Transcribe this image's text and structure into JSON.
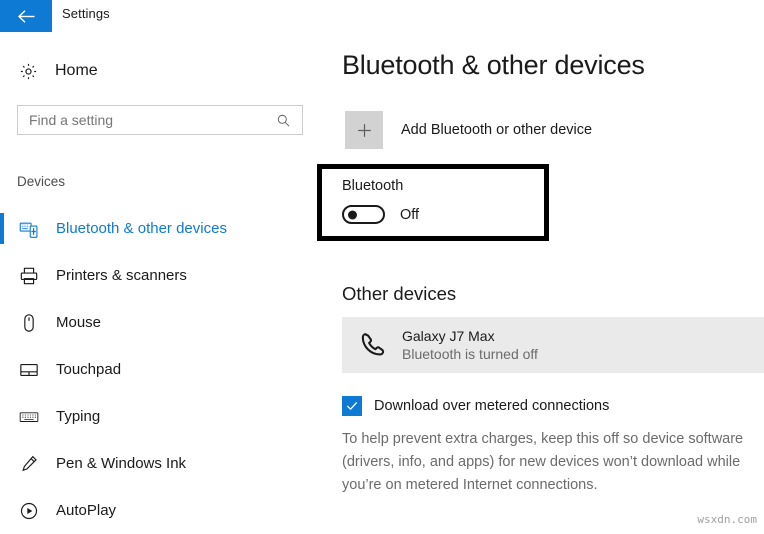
{
  "window": {
    "title": "Settings",
    "back_icon": "back-arrow-icon",
    "accent_color": "#0f7ad4"
  },
  "sidebar": {
    "home_label": "Home",
    "home_icon": "gear-icon",
    "search": {
      "placeholder": "Find a setting",
      "value": "",
      "icon": "search-icon"
    },
    "section_label": "Devices",
    "items": [
      {
        "label": "Bluetooth & other devices",
        "icon": "bluetooth-devices-icon",
        "selected": true
      },
      {
        "label": "Printers & scanners",
        "icon": "printer-icon",
        "selected": false
      },
      {
        "label": "Mouse",
        "icon": "mouse-icon",
        "selected": false
      },
      {
        "label": "Touchpad",
        "icon": "touchpad-icon",
        "selected": false
      },
      {
        "label": "Typing",
        "icon": "keyboard-icon",
        "selected": false
      },
      {
        "label": "Pen & Windows Ink",
        "icon": "pen-icon",
        "selected": false
      },
      {
        "label": "AutoPlay",
        "icon": "autoplay-icon",
        "selected": false
      }
    ]
  },
  "main": {
    "page_title": "Bluetooth & other devices",
    "add_device": {
      "label": "Add Bluetooth or other device",
      "icon": "plus-icon"
    },
    "bluetooth": {
      "heading": "Bluetooth",
      "toggle_state": "Off",
      "toggle_on": false,
      "highlighted": true
    },
    "other_devices": {
      "heading": "Other devices",
      "devices": [
        {
          "name": "Galaxy J7 Max",
          "status": "Bluetooth is turned off",
          "icon": "phone-handset-icon"
        }
      ]
    },
    "metered": {
      "checkbox_checked": true,
      "checkbox_color": "#0f7ad4",
      "label": "Download over metered connections",
      "description": "To help prevent extra charges, keep this off so device software (drivers, info, and apps) for new devices won’t download while you’re on metered Internet connections."
    }
  },
  "watermark": "wsxdn.com"
}
